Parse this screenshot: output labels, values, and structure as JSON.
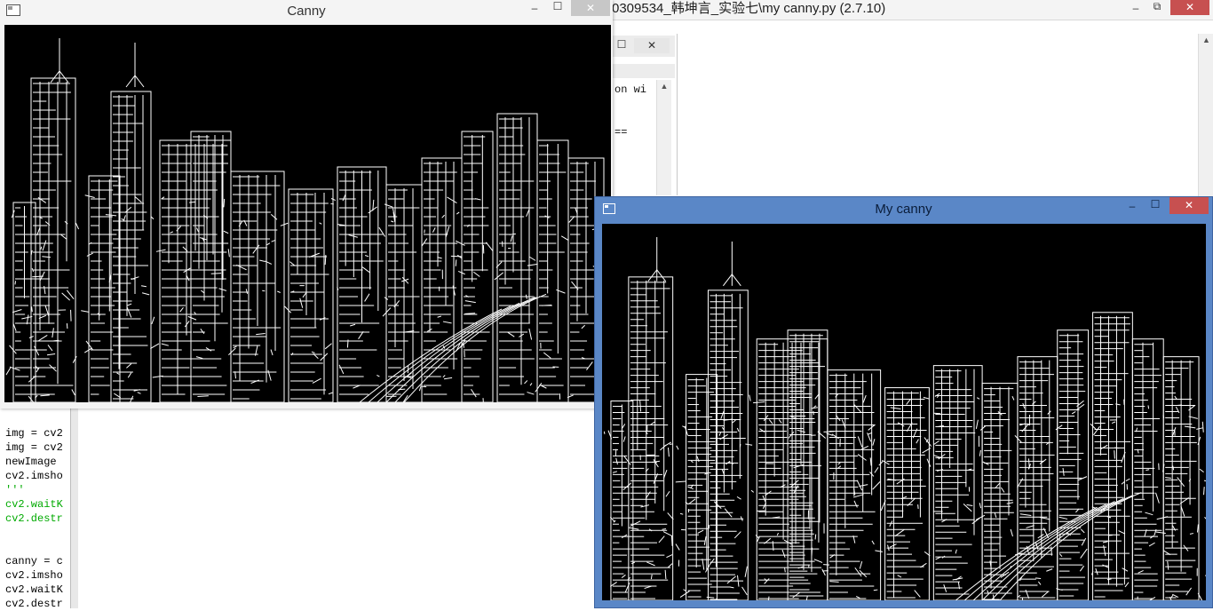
{
  "editor": {
    "title": "0309534_韩坤言_实验七\\my canny.py (2.7.10)",
    "min_icon": "minimize-icon",
    "restore_icon": "restore-icon",
    "close_icon": "close-icon",
    "min_glyph": "–",
    "restore_glyph": "⧉",
    "close_glyph": "✕",
    "scroll_up_glyph": "▲"
  },
  "shell": {
    "max_glyph": "☐",
    "close_glyph": "✕",
    "scroll_up_glyph": "▲",
    "lines": [
      "on wi",
      "=="
    ]
  },
  "code": {
    "lines": [
      {
        "text": "img = cv2",
        "color": "#000000"
      },
      {
        "text": "img = cv2",
        "color": "#000000"
      },
      {
        "text": "newImage",
        "color": "#000000"
      },
      {
        "text": "cv2.imsho",
        "color": "#000000"
      },
      {
        "text": "'''",
        "color": "#00aa00"
      },
      {
        "text": "cv2.waitK",
        "color": "#00aa00"
      },
      {
        "text": "cv2.destr",
        "color": "#00aa00"
      },
      {
        "text": "",
        "color": "#000000"
      },
      {
        "text": "",
        "color": "#000000"
      },
      {
        "text": "canny = c",
        "color": "#000000"
      },
      {
        "text": "cv2.imsho",
        "color": "#000000"
      },
      {
        "text": "cv2.waitK",
        "color": "#000000"
      },
      {
        "text": "cv2.destr",
        "color": "#000000"
      }
    ]
  },
  "canny_window": {
    "title": "Canny",
    "min_glyph": "–",
    "max_glyph": "☐",
    "close_glyph": "✕",
    "image": "canny-edge-image"
  },
  "my_canny_window": {
    "title": "My canny",
    "min_glyph": "–",
    "max_glyph": "☐",
    "close_glyph": "✕",
    "image": "my-canny-edge-image"
  },
  "colors": {
    "active_titlebar": "#5a87c7",
    "close_button_active": "#c75050",
    "edge": "#ffffff",
    "image_background": "#000000"
  }
}
